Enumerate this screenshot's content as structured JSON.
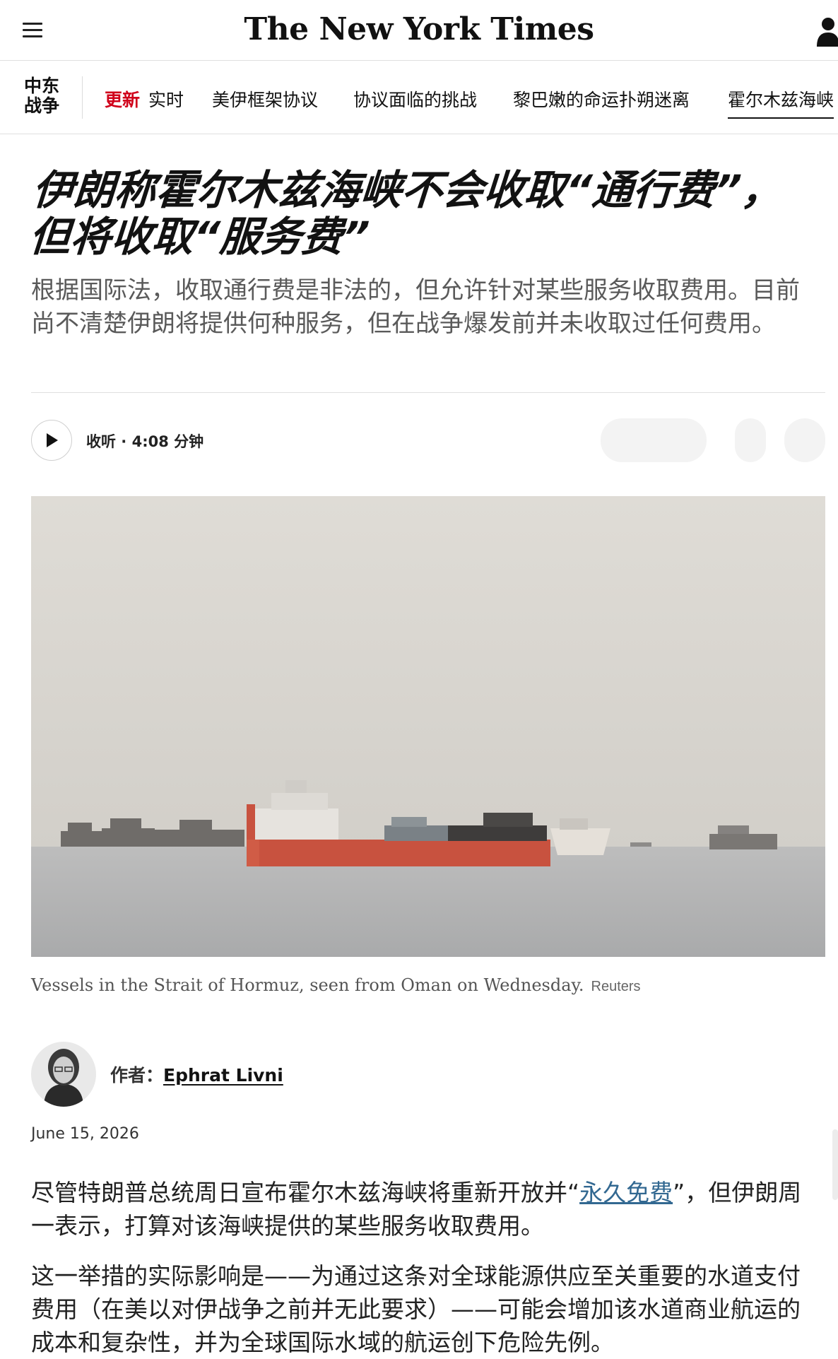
{
  "masthead": {
    "logo": "The New York Times",
    "menu_icon": "hamburger-menu-icon",
    "account_icon": "account-icon"
  },
  "section_nav": {
    "section_label": "中东战争",
    "update_badge": "更新",
    "items": [
      "实时",
      "美伊框架协议",
      "协议面临的挑战",
      "黎巴嫩的命运扑朔迷离",
      "霍尔木兹海峡"
    ]
  },
  "article": {
    "headline": "伊朗称霍尔木兹海峡不会收取“通行费”，但将收取“服务费”",
    "summary": "根据国际法，收取通行费是非法的，但允许针对某些服务收取费用。目前尚不清楚伊朗将提供何种服务，但在战争爆发前并未收取过任何费用。",
    "listen_label": "收听 · 4:08 分钟",
    "photo_caption": "Vessels in the Strait of Hormuz, seen from Oman on Wednesday.",
    "photo_credit": "Reuters",
    "byline_prefix": "作者：",
    "author": "Ephrat Livni",
    "date": "June 15, 2026",
    "paragraphs": [
      {
        "before": "尽管特朗普总统周日宣布霍尔木兹海峡将重新开放并“",
        "link": "永久免费",
        "after": "”，但伊朗周一表示，打算对该海峡提供的某些服务收取费用。"
      },
      {
        "text": "这一举措的实际影响是——为通过这条对全球能源供应至关重要的水道支付费用（在美以对伊战争之前并无此要求）——可能会增加该水道商业航运的成本和复杂性，并为全球国际水域的航运创下危险先例。"
      }
    ]
  },
  "colors": {
    "update_red": "#d0021b",
    "link_blue": "#326891",
    "summary_gray": "#5a5a5a"
  }
}
